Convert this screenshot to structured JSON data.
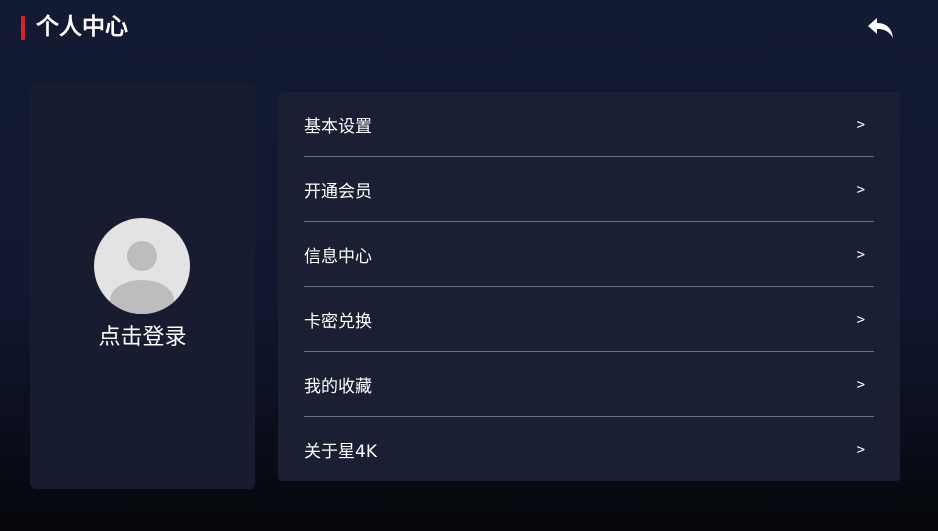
{
  "header": {
    "title": "个人中心",
    "accent_color": "#d9222a",
    "back_icon": "reply-arrow-icon"
  },
  "profile": {
    "avatar_icon": "default-avatar-icon",
    "login_label": "点击登录"
  },
  "menu": {
    "items": [
      {
        "label": "基本设置",
        "arrow": ">"
      },
      {
        "label": "开通会员",
        "arrow": ">"
      },
      {
        "label": "信息中心",
        "arrow": ">"
      },
      {
        "label": "卡密兑换",
        "arrow": ">"
      },
      {
        "label": "我的收藏",
        "arrow": ">"
      },
      {
        "label": "关于星4K",
        "arrow": ">"
      }
    ]
  }
}
